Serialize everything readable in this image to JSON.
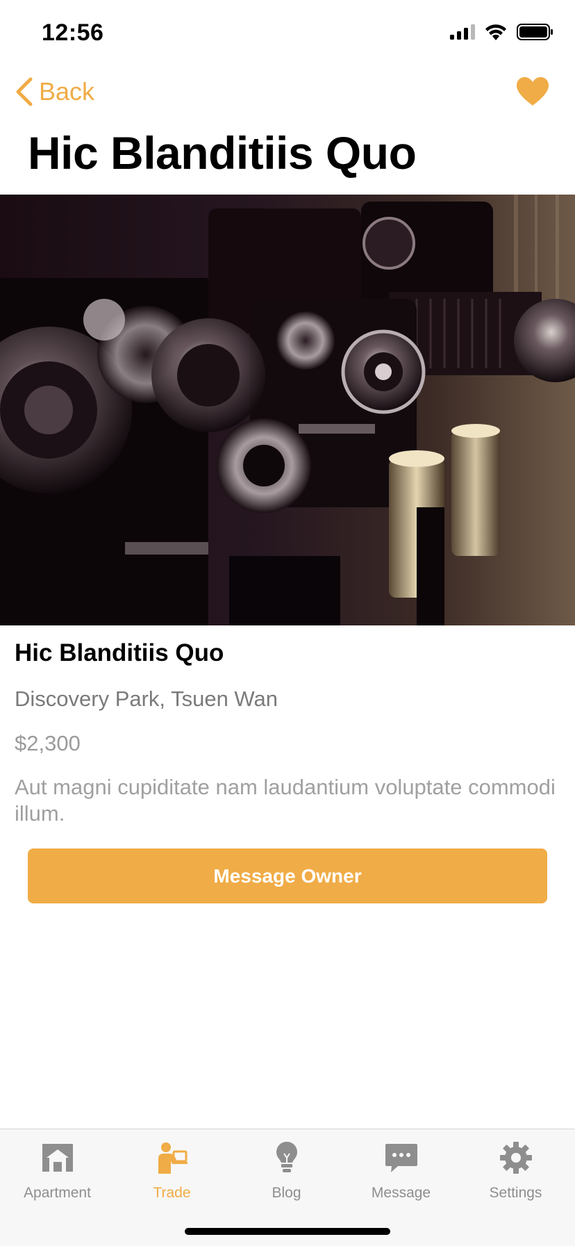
{
  "status_bar": {
    "time": "12:56"
  },
  "nav": {
    "back_label": "Back"
  },
  "page_title": "Hic Blanditiis Quo",
  "item": {
    "title": "Hic Blanditiis Quo",
    "location": "Discovery Park, Tsuen Wan",
    "price": "$2,300",
    "description": "Aut magni cupiditate nam laudantium voluptate commodi illum."
  },
  "actions": {
    "message_owner_label": "Message Owner"
  },
  "tabs": [
    {
      "label": "Apartment",
      "icon": "house-icon",
      "active": false
    },
    {
      "label": "Trade",
      "icon": "person-laptop-icon",
      "active": true
    },
    {
      "label": "Blog",
      "icon": "lightbulb-icon",
      "active": false
    },
    {
      "label": "Message",
      "icon": "chat-bubble-icon",
      "active": false
    },
    {
      "label": "Settings",
      "icon": "gear-icon",
      "active": false
    }
  ],
  "colors": {
    "accent": "#F0AC46",
    "inactive": "#8e8e8e",
    "tab_bar_bg": "#f7f7f7"
  }
}
